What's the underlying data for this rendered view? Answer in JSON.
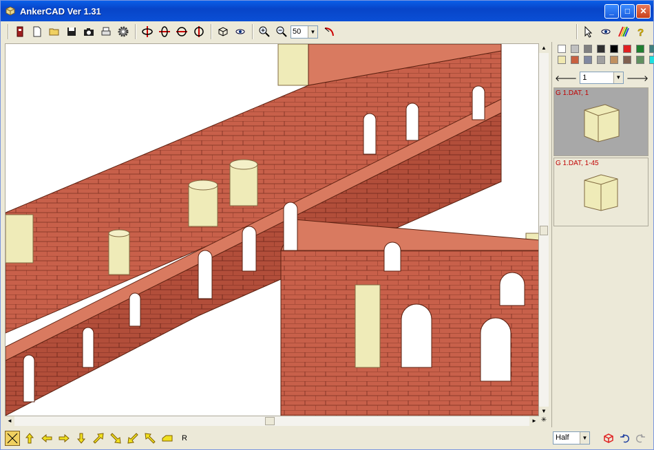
{
  "window": {
    "title": "AnkerCAD Ver 1.31",
    "min_label": "_",
    "max_label": "□",
    "close_label": "✕"
  },
  "toolbar": {
    "zoom_value": "50"
  },
  "palette": {
    "colors": [
      "#ffffff",
      "#c0c0c0",
      "#808080",
      "#303030",
      "#000000",
      "#e02020",
      "#208030",
      "#408080",
      "#f0e8b0",
      "#c86040",
      "#8088a0",
      "#a0a0a0",
      "#c09060",
      "#806050",
      "#609060",
      "#20e0e0"
    ]
  },
  "panel": {
    "group_value": "1",
    "items": [
      {
        "label": "G 1.DAT, 1"
      },
      {
        "label": "G 1.DAT, 1-45"
      }
    ]
  },
  "statusbar": {
    "r_label": "R",
    "view_value": "Half"
  },
  "colors": {
    "brick": "#c8604a",
    "stone": "#efebb8"
  }
}
